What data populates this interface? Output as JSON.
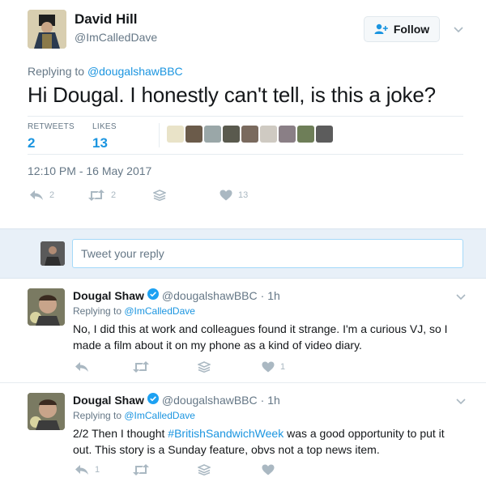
{
  "main_tweet": {
    "author_name": "David Hill",
    "author_handle": "@ImCalledDave",
    "follow_label": "Follow",
    "replying_prefix": "Replying to ",
    "replying_handle": "@dougalshawBBC",
    "text": "Hi Dougal. I honestly can't tell, is this a joke?",
    "stats": {
      "retweets_label": "RETWEETS",
      "retweets_value": "2",
      "likes_label": "LIKES",
      "likes_value": "13"
    },
    "timestamp": "12:10 PM - 16 May 2017",
    "actions": {
      "reply_count": "2",
      "retweet_count": "2",
      "like_count": "13"
    },
    "liker_colors": [
      "#e9e3c8",
      "#6b5b4a",
      "#9aa7a8",
      "#5a5a4e",
      "#7a6a5e",
      "#cfcac2",
      "#8a7f86",
      "#6e7e58",
      "#5c5c5c"
    ]
  },
  "reply_box": {
    "placeholder": "Tweet your reply"
  },
  "replies": [
    {
      "name": "Dougal Shaw",
      "handle": "@dougalshawBBC",
      "time": "· 1h",
      "replying_prefix": "Replying to ",
      "replying_handle": "@ImCalledDave",
      "text": "No, I did this at work and colleagues found it strange. I'm a curious VJ, so I made a film about it on my phone as a kind of video diary.",
      "reply_count": "",
      "retweet_count": "",
      "like_count": "1"
    },
    {
      "name": "Dougal Shaw",
      "handle": "@dougalshawBBC",
      "time": "· 1h",
      "replying_prefix": "Replying to ",
      "replying_handle": "@ImCalledDave",
      "text_before": "2/2 Then I thought ",
      "hashtag": "#BritishSandwichWeek",
      "text_after": " was a good opportunity to put it out. This story is a Sunday feature, obvs not a top news item.",
      "reply_count": "1",
      "retweet_count": "",
      "like_count": ""
    }
  ],
  "colors": {
    "accent": "#1b95e0",
    "muted": "#657786",
    "icon": "#aab8c2",
    "reply_area_bg": "#e8f0f8",
    "verified": "#1da1f2"
  },
  "icons": {
    "follow": "add-user-icon",
    "caret": "chevron-down-icon",
    "reply": "reply-icon",
    "retweet": "retweet-icon",
    "stack": "stack-icon",
    "like": "heart-icon",
    "verified": "verified-badge-icon"
  }
}
